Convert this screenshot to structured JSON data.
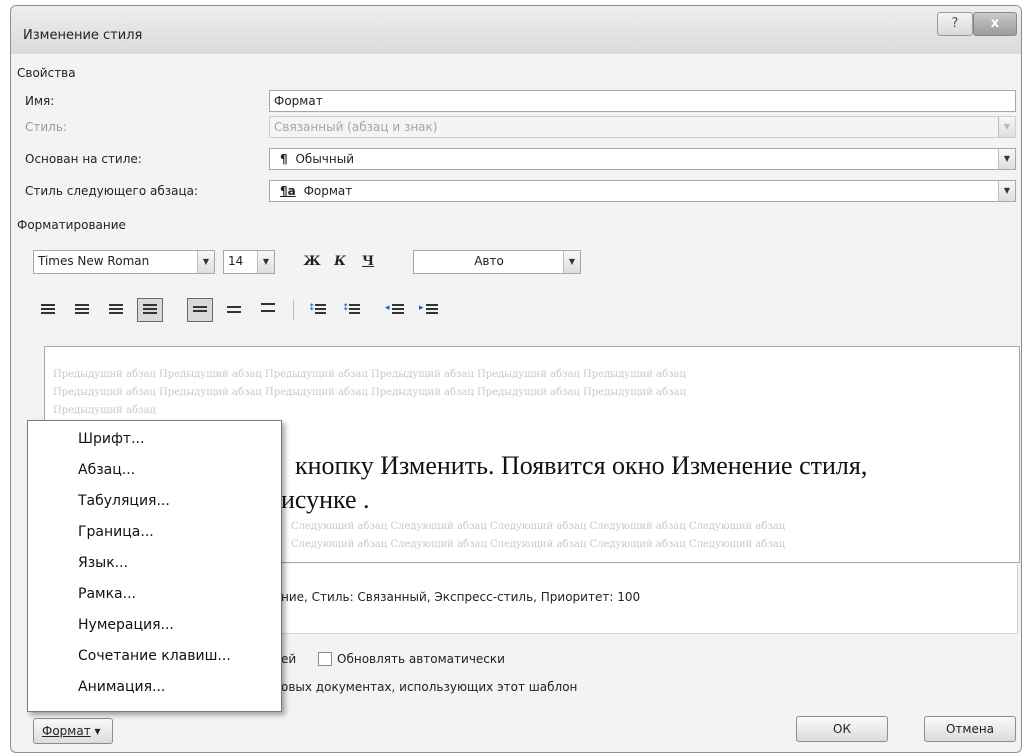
{
  "window": {
    "title": "Изменение стиля",
    "help_glyph": "?",
    "close_glyph": "x"
  },
  "properties": {
    "heading": "Свойства",
    "name_label": "Имя:",
    "name_value": "Формат",
    "type_label": "Стиль:",
    "type_value": "Связанный (абзац и знак)",
    "based_label": "Основан на стиле:",
    "based_icon": "¶",
    "based_value": "Обычный",
    "next_label": "Стиль следующего абзаца:",
    "next_icon": "¶a",
    "next_value": "Формат"
  },
  "formatting": {
    "heading": "Форматирование",
    "font": "Times New Roman",
    "size": "14",
    "bold": "Ж",
    "italic": "К",
    "underline": "Ч",
    "color": "Авто"
  },
  "preview": {
    "ghost_lines": [
      "Предыдущий абзац Предыдущий абзац Предыдущий абзац Предыдущий абзац Предыдущий абзац Предыдущий абзац",
      "Предыдущий абзац Предыдущий абзац Предыдущий абзац Предыдущий абзац Предыдущий абзац Предыдущий абзац",
      "Предыдущий абзац"
    ],
    "sample_line1": "кнопку Изменить. Появится окно Изменение стиля,",
    "sample_line2": "исунке .",
    "ghost_after": [
      "Следующий абзац Следующий абзац Следующий абзац Следующий абзац Следующий абзац",
      "Следующий абзац Следующий абзац Следующий абзац Следующий абзац Следующий абзац"
    ]
  },
  "description": "ние, Стиль: Связанный, Экспресс-стиль, Приоритет: 100",
  "options": {
    "add_suffix": "ей",
    "auto_update": "Обновлять автоматически",
    "new_docs": "овых документах, использующих этот шаблон"
  },
  "menu": {
    "items": [
      "Шрифт...",
      "Абзац...",
      "Табуляция...",
      "Граница...",
      "Язык...",
      "Рамка...",
      "Нумерация...",
      "Сочетание клавиш...",
      "Анимация..."
    ]
  },
  "buttons": {
    "format": "Формат",
    "format_arrow": "▾",
    "ok": "ОК",
    "cancel": "Отмена"
  },
  "dropdown_arrow": "▼"
}
